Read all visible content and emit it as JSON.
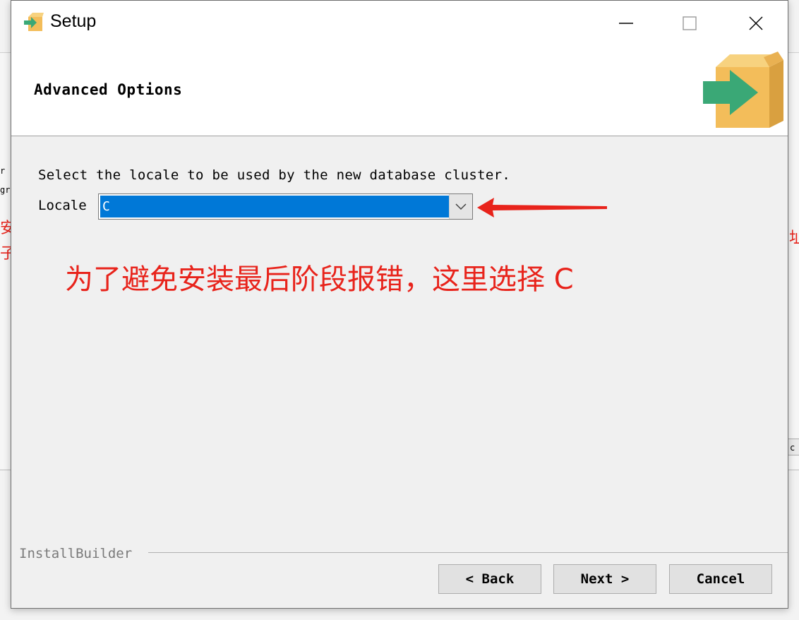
{
  "background": {
    "fragments": [
      "r *",
      "gr",
      "c"
    ],
    "red_fragments": [
      "安",
      "子",
      "址"
    ]
  },
  "window": {
    "title": "Setup",
    "icon": "setup-box-icon",
    "controls": [
      "minimize-icon",
      "maximize-icon",
      "close-icon"
    ]
  },
  "header": {
    "title": "Advanced Options",
    "icon": "installer-box-arrow-icon"
  },
  "content": {
    "prompt": "Select the locale to be used by the new database cluster.",
    "locale_label": "Locale",
    "locale_value": "C",
    "annotation": "为了避免安装最后阶段报错，这里选择 C",
    "annotation_color": "#e8231b"
  },
  "footer": {
    "brand": "InstallBuilder",
    "back_label": "< Back",
    "next_label": "Next >",
    "cancel_label": "Cancel"
  },
  "colors": {
    "selection": "#0078d7",
    "annotation_red": "#e8231b",
    "box_yellow": "#f3bd5a",
    "arrow_green": "#3aa876"
  }
}
